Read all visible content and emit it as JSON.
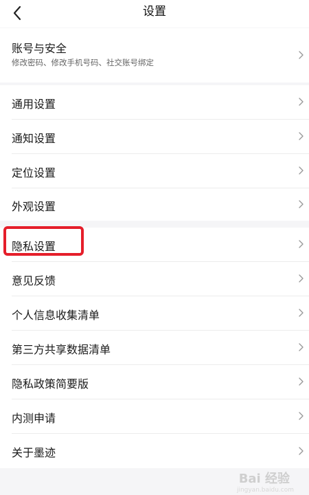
{
  "header": {
    "title": "设置",
    "back_icon": "back-chevron-icon"
  },
  "account": {
    "label": "账号与安全",
    "subtitle": "修改密码、修改手机号码、社交账号绑定"
  },
  "group_general": [
    {
      "label": "通用设置"
    },
    {
      "label": "通知设置"
    },
    {
      "label": "定位设置"
    },
    {
      "label": "外观设置"
    }
  ],
  "group_privacy": [
    {
      "label": "隐私设置"
    },
    {
      "label": "意见反馈"
    },
    {
      "label": "个人信息收集清单"
    },
    {
      "label": "第三方共享数据清单"
    },
    {
      "label": "隐私政策简要版"
    },
    {
      "label": "内测申请"
    },
    {
      "label": "关于墨迹"
    }
  ],
  "highlight": {
    "target": "隐私设置",
    "color": "#e51e2a"
  },
  "watermark": {
    "text": "Bai 经验",
    "sub": "jingyan.baidu.com"
  }
}
